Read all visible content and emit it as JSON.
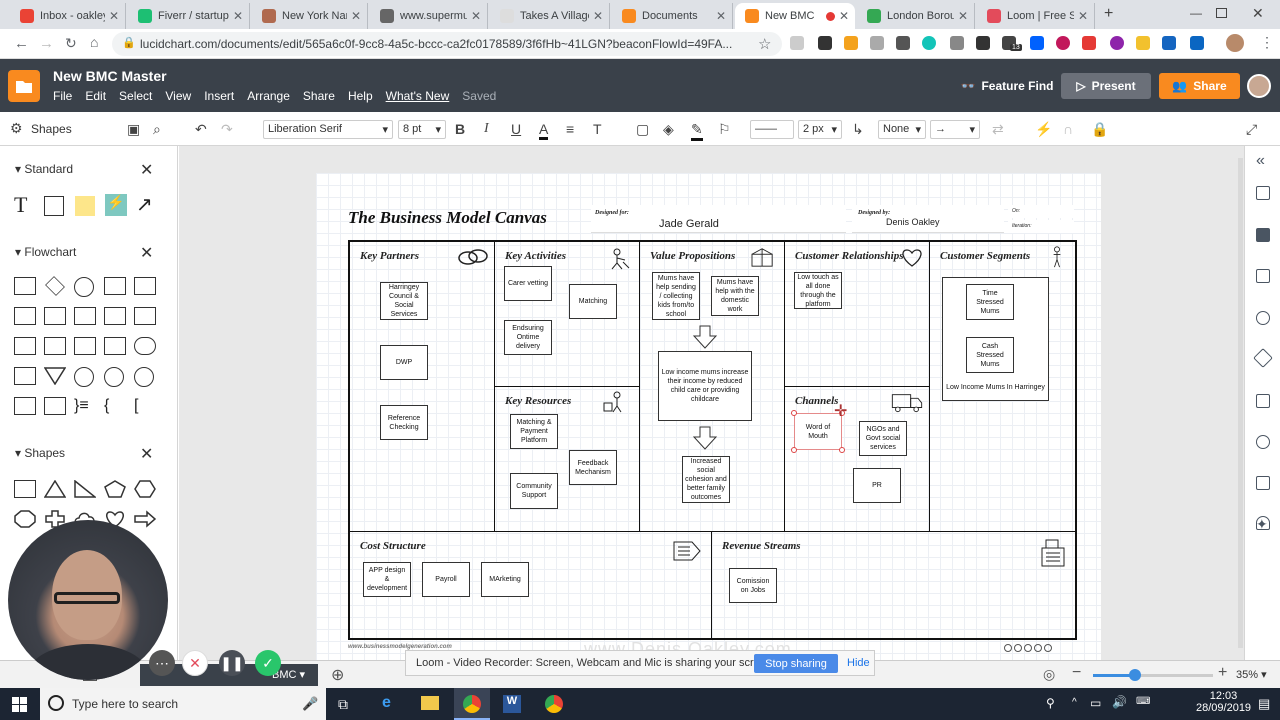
{
  "browser": {
    "tabs": [
      {
        "label": "Inbox - oakley",
        "fav": "gmail-icon",
        "color": "#ea4335"
      },
      {
        "label": "Fiverr / startup",
        "fav": "fiverr-icon",
        "color": "#1dbf73"
      },
      {
        "label": "New York Nann",
        "fav": "page-icon",
        "color": "#b06a4f"
      },
      {
        "label": "www.supermum",
        "fav": "globe-icon",
        "color": "#666666"
      },
      {
        "label": "Takes A Village",
        "fav": "doc-icon",
        "color": "#dddddd"
      },
      {
        "label": "Documents",
        "fav": "lucid-icon",
        "color": "#f98a1f"
      },
      {
        "label": "New BMC",
        "fav": "lucid-icon",
        "color": "#f98a1f"
      },
      {
        "label": "London Borou",
        "fav": "maps-icon",
        "color": "#34a853"
      },
      {
        "label": "Loom | Free Sc",
        "fav": "loom-icon",
        "color": "#e34b5b"
      }
    ],
    "url": "lucidchart.com/documents/edit/565a6c0f-9cc8-4a5c-bccc-ca2fc0178589/3f6fHb~41LGN?beaconFlowId=49FA...",
    "ext_badge": "13"
  },
  "app": {
    "doc_title": "New BMC Master",
    "menu": [
      "File",
      "Edit",
      "Select",
      "View",
      "Insert",
      "Arrange",
      "Share",
      "Help",
      "What's New",
      "Saved"
    ],
    "feature_find": "Feature Find",
    "present": "Present",
    "share": "Share",
    "colors": {
      "header": "#3a414a",
      "accent": "#f98a1f",
      "present": "#6b7079"
    }
  },
  "toolbar": {
    "shapes_label": "Shapes",
    "font": "Liberation Serif",
    "font_size": "8 pt",
    "line_width": "2 px",
    "arrow_start": "None"
  },
  "left_panel": {
    "sections": [
      {
        "title": "Standard"
      },
      {
        "title": "Flowchart"
      },
      {
        "title": "Shapes"
      }
    ]
  },
  "canvas": {
    "title": "The Business Model Canvas",
    "designed_for_label": "Designed for:",
    "designed_for": "Jade Gerald",
    "designed_by_label": "Designed by:",
    "designed_by": "Denis Oakley",
    "on_label": "On:",
    "iteration_label": "Iteration:",
    "footer_url": "www.businessmodelgeneration.com",
    "watermark": "www.Denis Oakley.com",
    "blocks": {
      "key_partners": "Key Partners",
      "key_activities": "Key Activities",
      "key_resources": "Key Resources",
      "value_propositions": "Value Propositions",
      "customer_relationships": "Customer Relationships",
      "channels": "Channels",
      "customer_segments": "Customer Segments",
      "cost_structure": "Cost Structure",
      "revenue_streams": "Revenue Streams"
    },
    "notes": {
      "kp1": "Harringey Council & Social Services",
      "kp2": "DWP",
      "kp3": "Reference Checking",
      "ka1": "Carer vetting",
      "ka2": "Matching",
      "ka3": "Endsuring Ontime delivery",
      "kr1": "Matching & Payment Platform",
      "kr2": "Feedback Mechanism",
      "kr3": "Community Support",
      "vp1": "Mums have help sending / collecting kids from/to school",
      "vp2": "Mums have help with the domestic work",
      "vp3": "Low income mums increase their income by reduced child care or providing childcare",
      "vp4": "Increased social cohesion and better family outcomes",
      "cr1": "Low touch as all done through the platform",
      "ch1": "Word of Mouth",
      "ch2": "NGOs and Govt social services",
      "ch3": "PR",
      "cs1": "Time Stressed Mums",
      "cs2": "Cash Stressed Mums",
      "cs3": "Low Income Mums In Harringey",
      "cost1": "APP design & development",
      "cost2": "Payroll",
      "cost3": "MArketing",
      "rev1": "Comission on Jobs"
    }
  },
  "bottom": {
    "page_tab": "BMC",
    "loom_msg": "Loom - Video Recorder: Screen, Webcam and Mic is sharing your screen.",
    "stop_sharing": "Stop sharing",
    "hide": "Hide",
    "zoom": "35%",
    "zoom_level": 0.35
  },
  "taskbar": {
    "search_placeholder": "Type here to search",
    "time": "12:03",
    "date": "28/09/2019"
  }
}
